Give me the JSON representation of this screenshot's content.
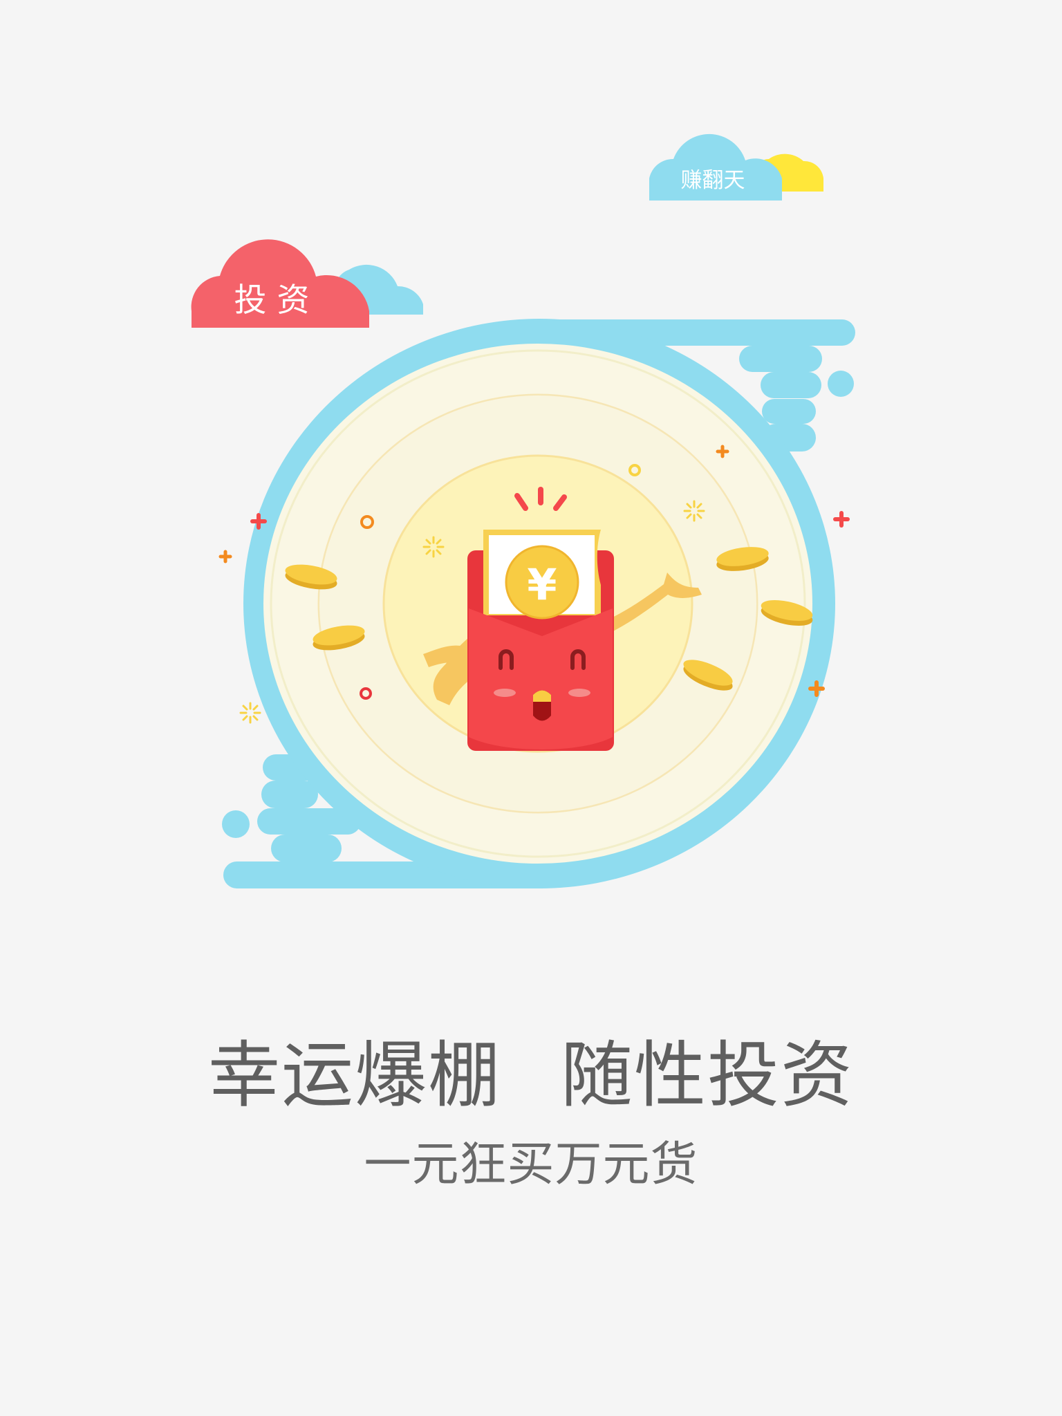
{
  "clouds": {
    "top_right_label": "赚翻天",
    "left_label": "投 资"
  },
  "illustration": {
    "envelope_symbol": "¥",
    "icons": [
      "red-envelope-icon",
      "coin-icon",
      "yuan-coin-icon",
      "sparkle-icon",
      "plus-icon",
      "ring-icon"
    ]
  },
  "headline": {
    "part1": "幸运爆棚",
    "part2": "随性投资"
  },
  "subline": "一元狂买万元货",
  "colors": {
    "background": "#f5f5f5",
    "sky_blue": "#8fdcef",
    "cloud_red": "#f4626a",
    "cloud_yellow": "#ffe73a",
    "plate_cream": "#faf7e4",
    "inner_yellow": "#fdf3b9",
    "envelope_red": "#f4474b",
    "coin_gold": "#f8cc43",
    "text_gray": "#5f5f5f"
  }
}
